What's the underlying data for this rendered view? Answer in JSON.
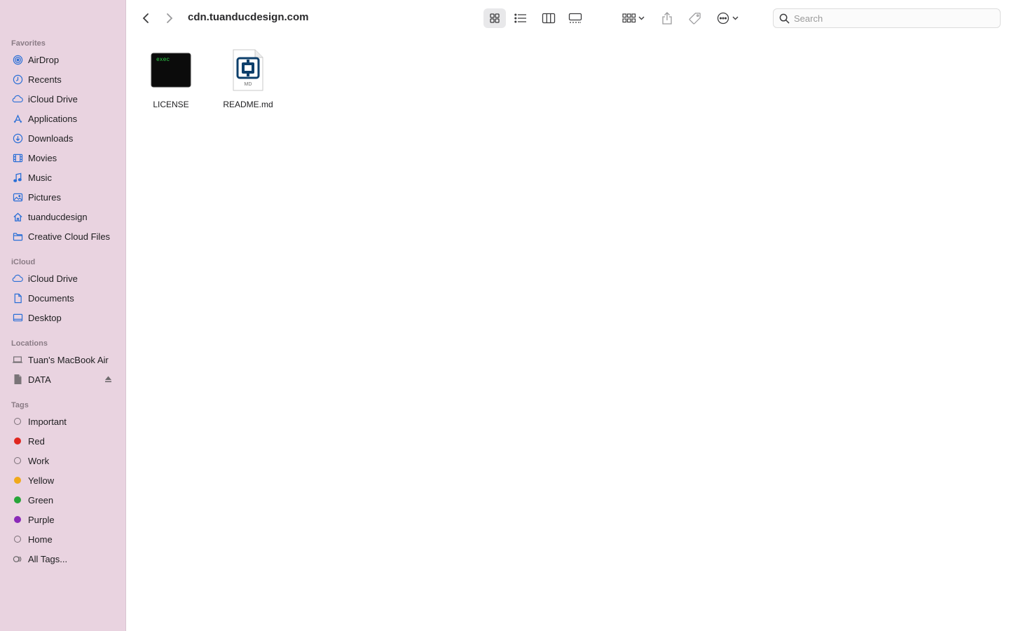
{
  "sidebar": {
    "sections": {
      "favorites": "Favorites",
      "icloud": "iCloud",
      "locations": "Locations",
      "tags": "Tags"
    },
    "favorites": [
      {
        "label": "AirDrop",
        "icon": "airdrop-icon"
      },
      {
        "label": "Recents",
        "icon": "clock-icon"
      },
      {
        "label": "iCloud Drive",
        "icon": "cloud-icon"
      },
      {
        "label": "Applications",
        "icon": "applications-icon"
      },
      {
        "label": "Downloads",
        "icon": "download-icon"
      },
      {
        "label": "Movies",
        "icon": "film-icon"
      },
      {
        "label": "Music",
        "icon": "music-note-icon"
      },
      {
        "label": "Pictures",
        "icon": "photo-icon"
      },
      {
        "label": "tuanducdesign",
        "icon": "home-icon"
      },
      {
        "label": "Creative Cloud Files",
        "icon": "folder-icon"
      }
    ],
    "icloud": [
      {
        "label": "iCloud Drive",
        "icon": "cloud-icon"
      },
      {
        "label": "Documents",
        "icon": "document-icon"
      },
      {
        "label": "Desktop",
        "icon": "desktop-icon"
      }
    ],
    "locations": [
      {
        "label": "Tuan's MacBook Air",
        "icon": "laptop-icon"
      },
      {
        "label": "DATA",
        "icon": "drive-icon"
      }
    ],
    "tags": [
      {
        "label": "Important",
        "color": ""
      },
      {
        "label": "Red",
        "color": "#e0271f"
      },
      {
        "label": "Work",
        "color": ""
      },
      {
        "label": "Yellow",
        "color": "#f0a91a"
      },
      {
        "label": "Green",
        "color": "#27a539"
      },
      {
        "label": "Purple",
        "color": "#8a2ab8"
      },
      {
        "label": "Home",
        "color": ""
      },
      {
        "label": "All Tags...",
        "color": ""
      }
    ]
  },
  "toolbar": {
    "title": "cdn.tuanducdesign.com",
    "search_placeholder": "Search"
  },
  "files": [
    {
      "name": "LICENSE",
      "thumb_text": "exec",
      "type": "executable"
    },
    {
      "name": "README.md",
      "thumb_text": "MD",
      "type": "markdown"
    }
  ],
  "colors": {
    "sidebar_bg": "#e9d3e0",
    "accent": "#2a6fd6"
  }
}
